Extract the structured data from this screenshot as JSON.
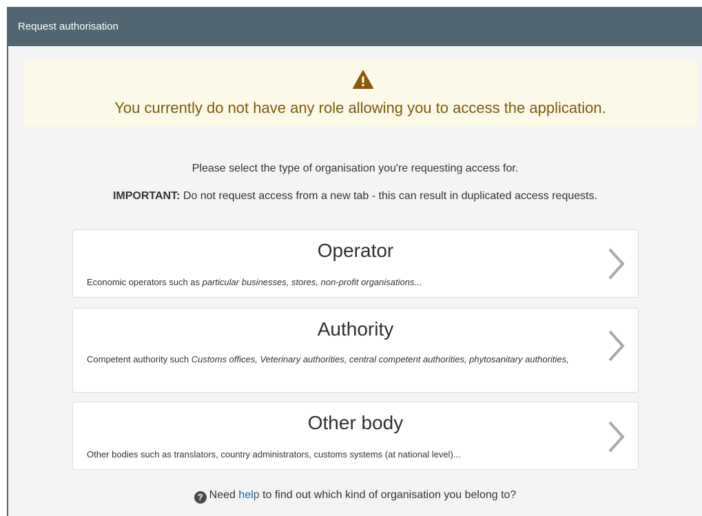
{
  "panel": {
    "title": "Request authorisation"
  },
  "warning": {
    "icon": "warning-triangle-icon",
    "message": "You currently do not have any role allowing you to access the application."
  },
  "instructions": {
    "select_text": "Please select the type of organisation you're requesting access for.",
    "important_label": "IMPORTANT:",
    "important_text": " Do not request access from a new tab - this can result in duplicated access requests."
  },
  "cards": [
    {
      "title": "Operator",
      "desc_plain": "Economic operators such as ",
      "desc_italic": "particular businesses, stores, non-profit organisations..."
    },
    {
      "title": "Authority",
      "desc_plain": "Competent authority such ",
      "desc_italic": "Customs offices, Veterinary authorities, central competent authorities, phytosanitary authorities,"
    },
    {
      "title": "Other body",
      "desc_plain": "Other bodies such as translators, country administrators, customs systems (at national level)...",
      "desc_italic": ""
    }
  ],
  "help": {
    "icon": "question-circle-icon",
    "before": "Need ",
    "link": "help",
    "after": " to find out which kind of organisation you belong to?"
  },
  "colors": {
    "header_bg": "#526672",
    "warning_bg": "#fcf9e8",
    "warning_text": "#7a5a10",
    "link": "#1b5fa0"
  }
}
